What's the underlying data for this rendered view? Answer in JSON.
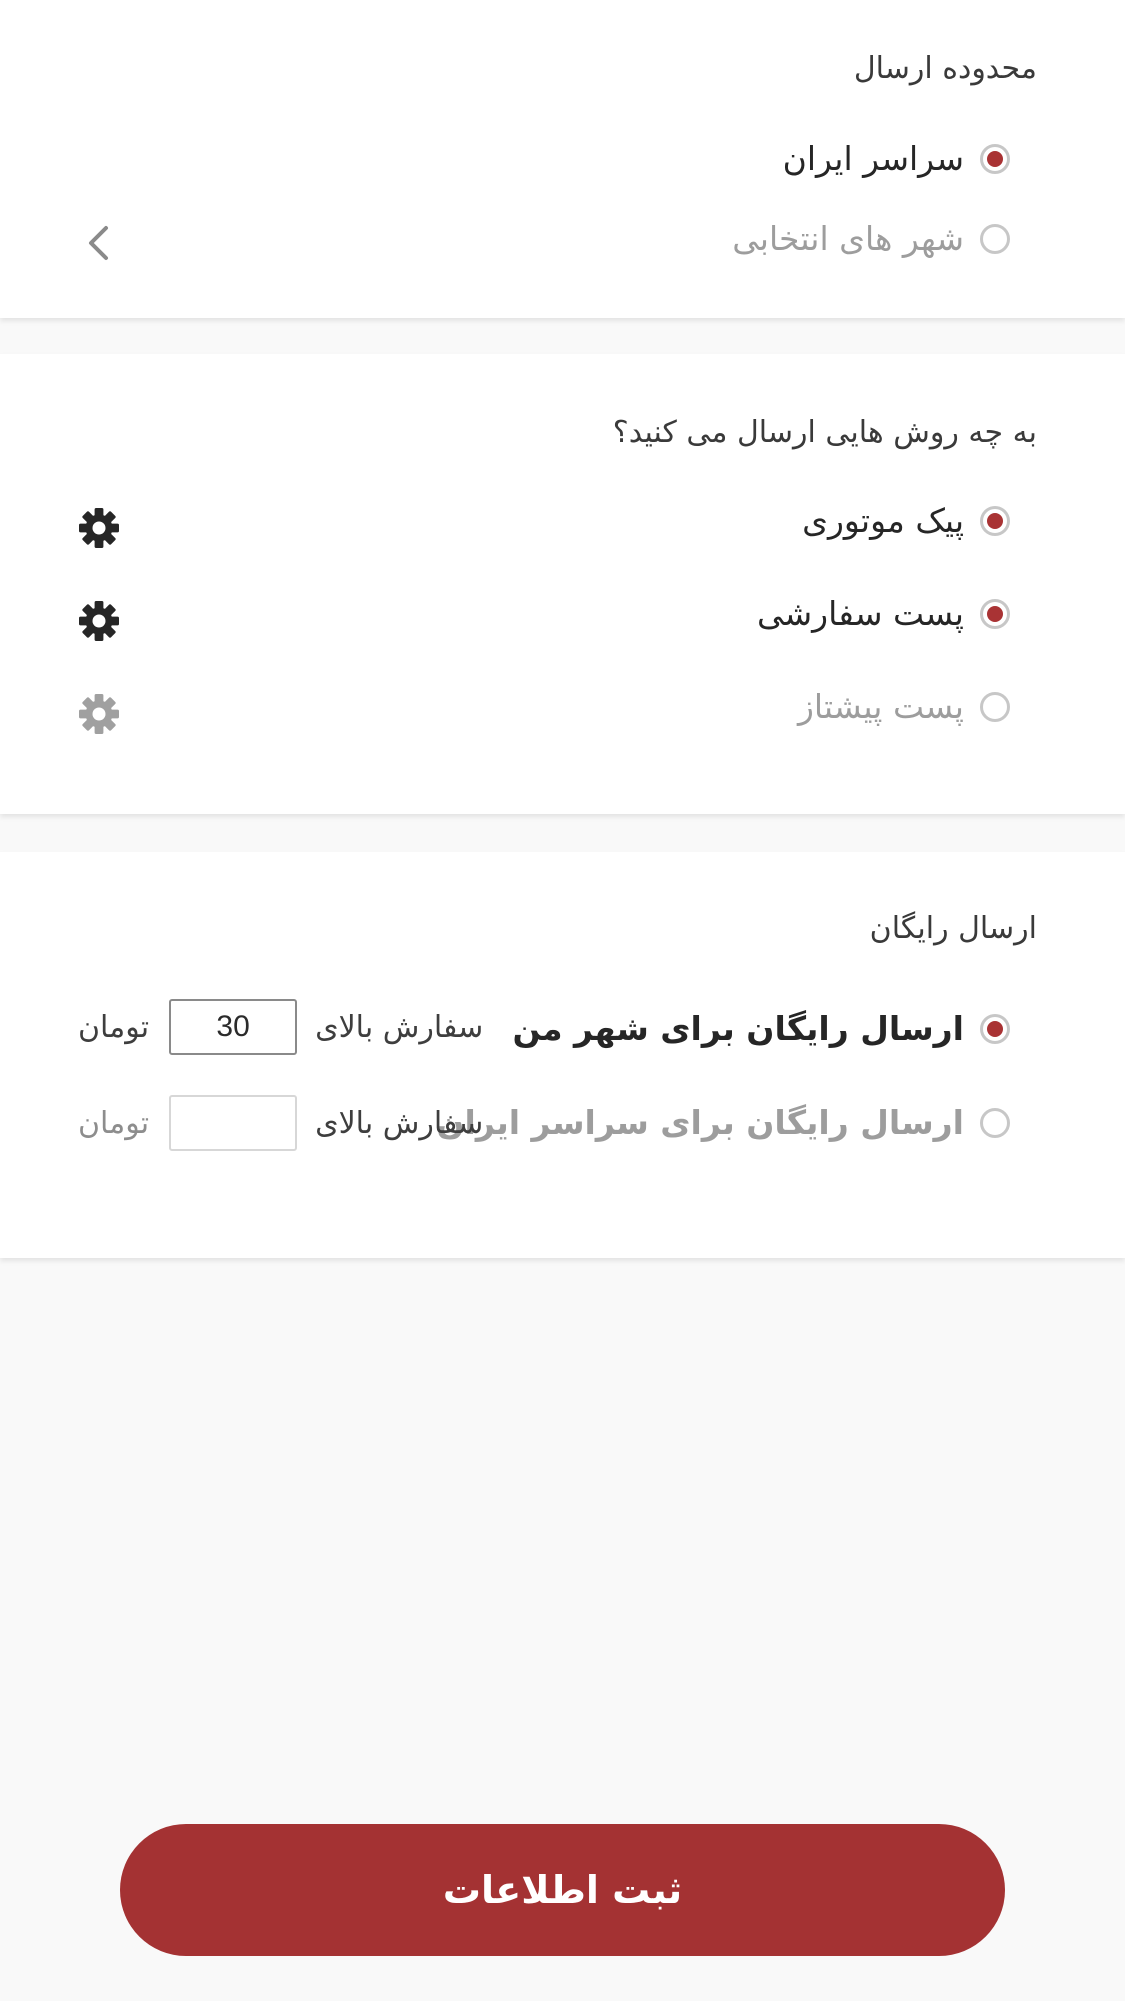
{
  "shipping_range": {
    "title": "محدوده ارسال",
    "options": [
      {
        "label": "سراسر ایران",
        "selected": true
      },
      {
        "label": "شهر های انتخابی",
        "selected": false
      }
    ]
  },
  "shipping_methods": {
    "title": "به چه روش هایی ارسال می کنید؟",
    "options": [
      {
        "label": "پیک موتوری",
        "selected": true
      },
      {
        "label": "پست سفارشی",
        "selected": true
      },
      {
        "label": "پست پیشتاز",
        "selected": false
      }
    ]
  },
  "free_shipping": {
    "title": "ارسال رایگان",
    "options": [
      {
        "label": "ارسال رایگان برای شهر من",
        "selected": true,
        "prefix": "سفارش بالای",
        "amount": "30",
        "unit": "تومان"
      },
      {
        "label": "ارسال رایگان برای سراسر ایران",
        "selected": false,
        "prefix": "سفارش بالای",
        "amount": "",
        "unit": "تومان"
      }
    ]
  },
  "submit": {
    "label": "ثبت اطلاعات"
  },
  "colors": {
    "accent": "#a93334",
    "button": "#a43233",
    "active_icon": "#262626",
    "inactive_icon": "#a0a0a0"
  },
  "icons": {
    "chevron": "chevron-left-icon",
    "settings": "gear-icon"
  }
}
